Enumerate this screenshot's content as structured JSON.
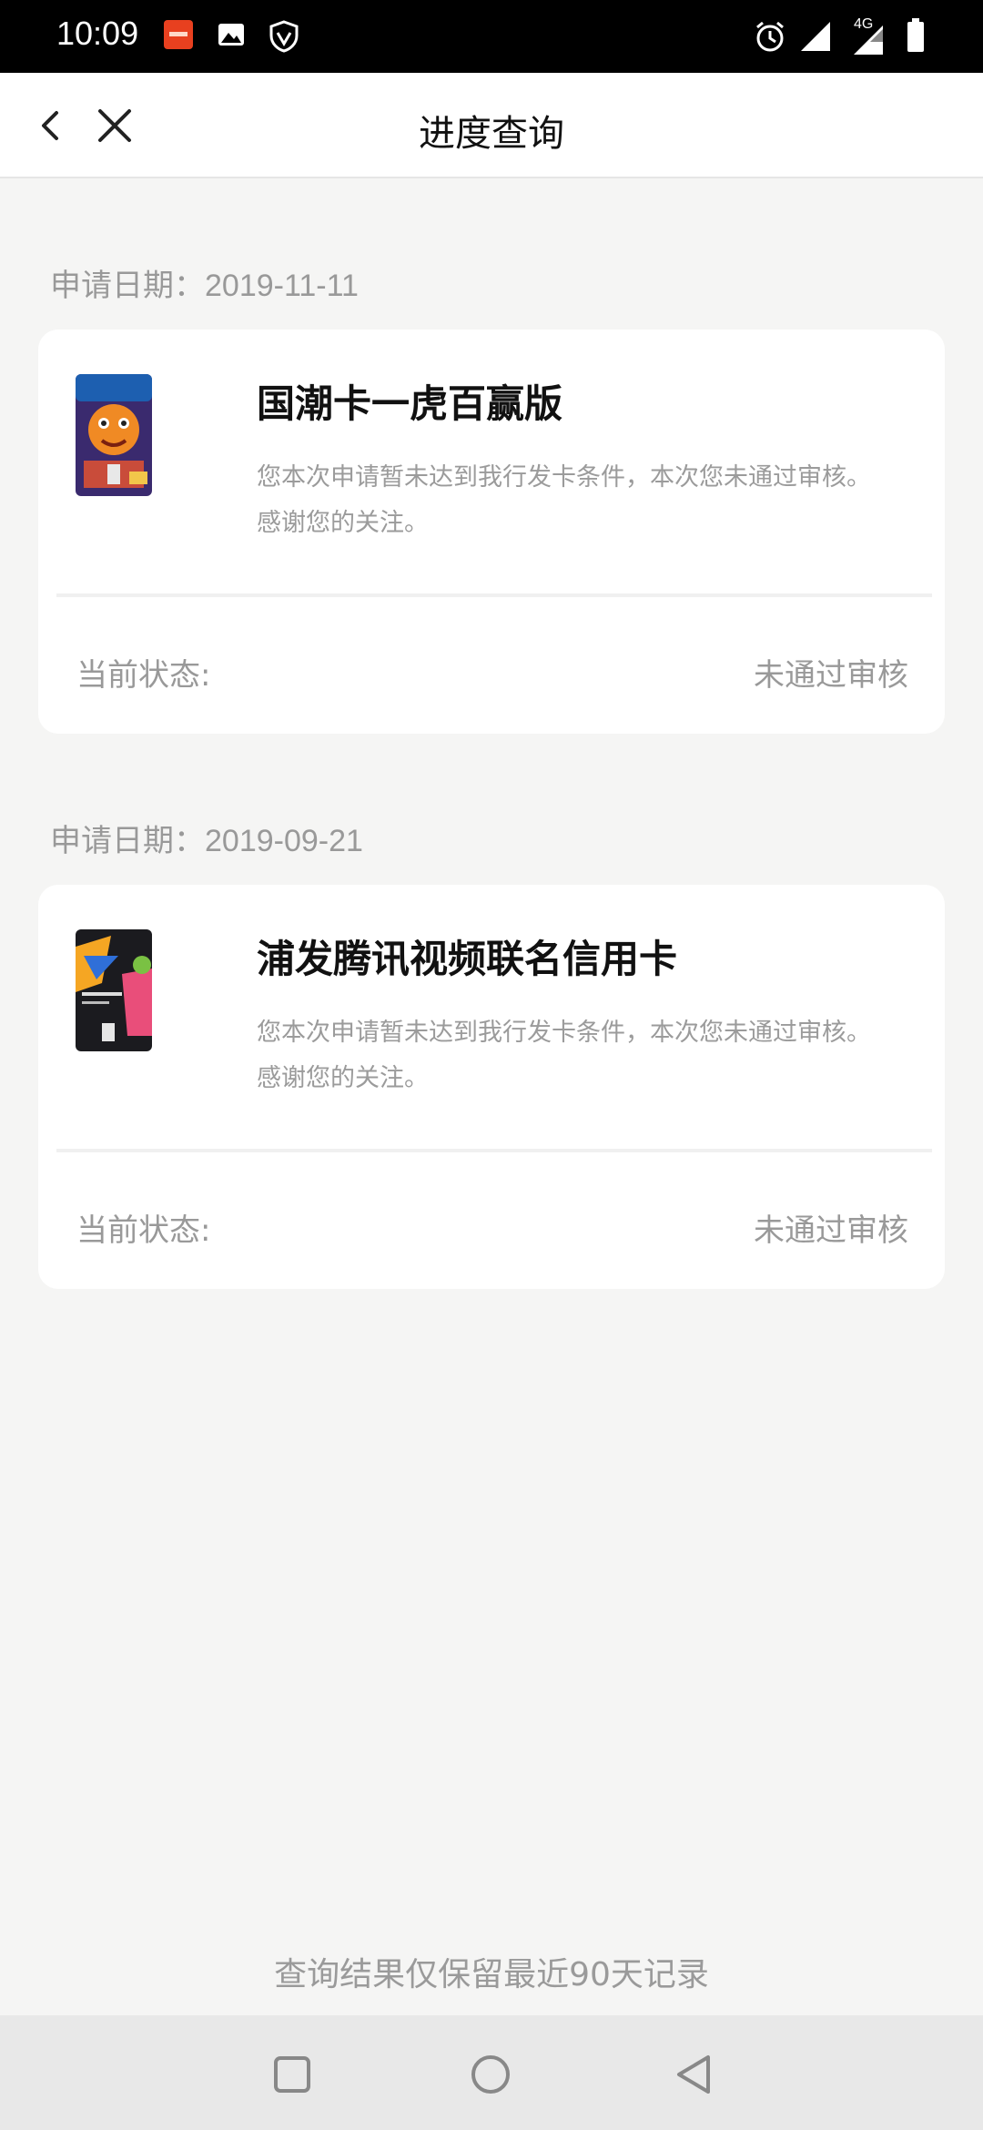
{
  "status_bar": {
    "time": "10:09",
    "network": "4G",
    "icons": [
      "bank-app-icon",
      "photo-icon",
      "shield-icon",
      "alarm-icon",
      "signal-icon",
      "signal-4g-icon",
      "battery-icon"
    ]
  },
  "header": {
    "title": "进度查询",
    "back_icon": "chevron-left-icon",
    "close_icon": "close-icon"
  },
  "applications": [
    {
      "date_label": "申请日期：2019-11-11",
      "card_name": "国潮卡一虎百赢版",
      "desc_line1": "您本次申请暂未达到我行发卡条件，本次您未通过审核。",
      "desc_line2": "感谢您的关注。",
      "status_label": "当前状态:",
      "status_value": "未通过审核",
      "thumb_icon": "tiger-card-image"
    },
    {
      "date_label": "申请日期：2019-09-21",
      "card_name": "浦发腾讯视频联名信用卡",
      "desc_line1": "您本次申请暂未达到我行发卡条件，本次您未通过审核。",
      "desc_line2": "感谢您的关注。",
      "status_label": "当前状态:",
      "status_value": "未通过审核",
      "thumb_icon": "tencent-video-card-image"
    }
  ],
  "footer_note": "查询结果仅保留最近90天记录",
  "nav": {
    "icons": [
      "recents-square-icon",
      "home-circle-icon",
      "back-triangle-icon"
    ]
  },
  "colors": {
    "background": "#f5f5f4",
    "card": "#ffffff",
    "muted_text": "#999999",
    "title_text": "#111111"
  }
}
